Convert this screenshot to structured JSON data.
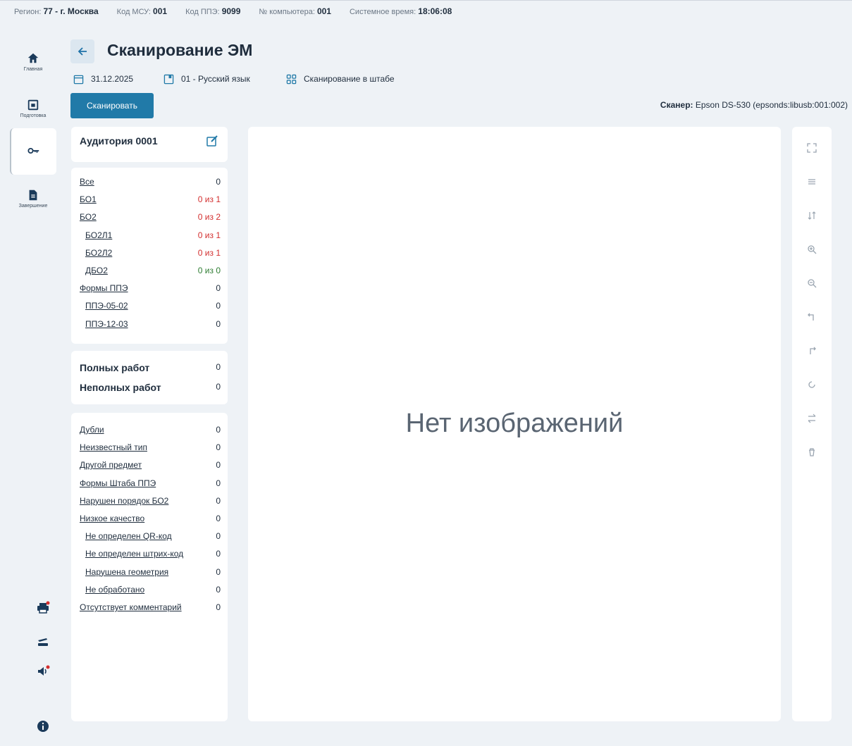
{
  "topbar": {
    "region_label": "Регион:",
    "region_value": "77 - г. Москва",
    "msu_label": "Код МСУ:",
    "msu_value": "001",
    "ppe_label": "Код ППЭ:",
    "ppe_value": "9099",
    "pc_label": "№ компьютера:",
    "pc_value": "001",
    "time_label": "Системное время:",
    "time_value": "18:06:08"
  },
  "nav": {
    "home": "Главная",
    "prep": "Подготовка",
    "finish": "Завершение"
  },
  "header": {
    "title": "Сканирование ЭМ",
    "date": "31.12.2025",
    "subject": "01 - Русский язык",
    "mode": "Сканирование в штабе",
    "scan_button": "Сканировать",
    "scanner_label": "Сканер:",
    "scanner_value": "Epson DS-530 (epsonds:libusb:001:002)"
  },
  "auditorium": {
    "title": "Аудитория 0001"
  },
  "counts": [
    {
      "label": "Все",
      "value": "0",
      "color": "normal",
      "indent": false
    },
    {
      "label": "БО1",
      "value": "0 из 1",
      "color": "red",
      "indent": false
    },
    {
      "label": "БО2",
      "value": "0 из 2",
      "color": "red",
      "indent": false
    },
    {
      "label": "БО2Л1",
      "value": "0 из 1",
      "color": "red",
      "indent": true
    },
    {
      "label": "БО2Л2",
      "value": "0 из 1",
      "color": "red",
      "indent": true
    },
    {
      "label": "ДБО2",
      "value": "0 из 0",
      "color": "green",
      "indent": true
    },
    {
      "label": "Формы ППЭ",
      "value": "0",
      "color": "normal",
      "indent": false
    },
    {
      "label": "ППЭ-05-02",
      "value": "0",
      "color": "normal",
      "indent": true
    },
    {
      "label": "ППЭ-12-03",
      "value": "0",
      "color": "normal",
      "indent": true
    }
  ],
  "works": [
    {
      "label": "Полных работ",
      "value": "0"
    },
    {
      "label": "Неполных работ",
      "value": "0"
    }
  ],
  "issues": [
    {
      "label": "Дубли",
      "value": "0",
      "indent": false
    },
    {
      "label": "Неизвестный тип",
      "value": "0",
      "indent": false
    },
    {
      "label": "Другой предмет",
      "value": "0",
      "indent": false
    },
    {
      "label": "Формы Штаба ППЭ",
      "value": "0",
      "indent": false
    },
    {
      "label": "Нарушен порядок БО2",
      "value": "0",
      "indent": false
    },
    {
      "label": "Низкое качество",
      "value": "0",
      "indent": false
    },
    {
      "label": "Не определен QR-код",
      "value": "0",
      "indent": true
    },
    {
      "label": "Не определен штрих-код",
      "value": "0",
      "indent": true
    },
    {
      "label": "Нарушена геометрия",
      "value": "0",
      "indent": true
    },
    {
      "label": "Не обработано",
      "value": "0",
      "indent": true
    },
    {
      "label": "Отсутствует комментарий",
      "value": "0",
      "indent": false
    }
  ],
  "viewer": {
    "empty_text": "Нет изображений"
  },
  "colors": {
    "accent": "#217aa8",
    "red": "#d32f2f",
    "green": "#2e7d32",
    "background": "#eef2f6"
  }
}
